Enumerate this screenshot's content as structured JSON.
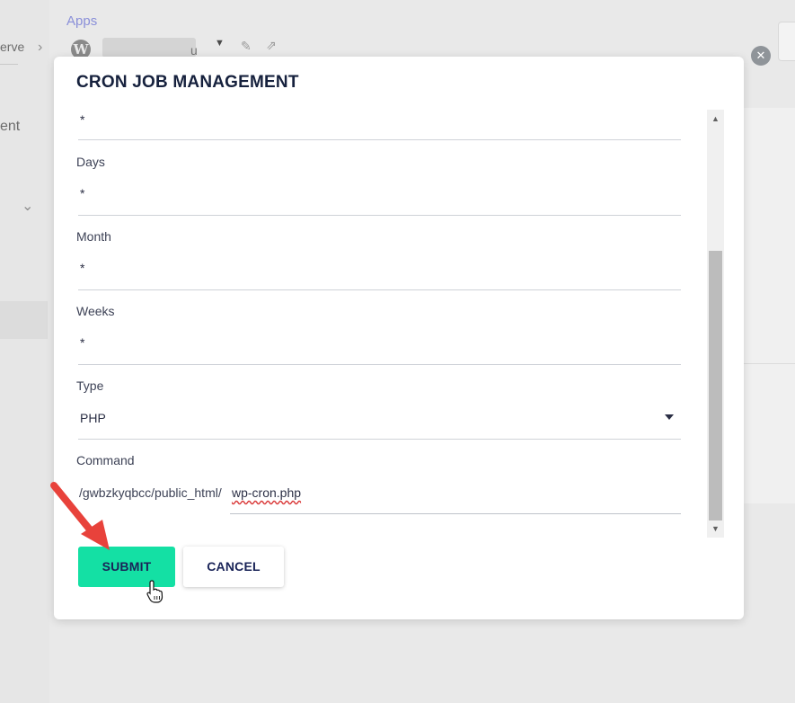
{
  "background": {
    "left_fragments": [
      "erve",
      "ent"
    ],
    "breadcrumb_apps": "Apps",
    "app_name_tail": "u",
    "wp_logo_letter": "W"
  },
  "modal": {
    "title": "CRON JOB MANAGEMENT",
    "fields": {
      "hours_value": "*",
      "days_label": "Days",
      "days_value": "*",
      "month_label": "Month",
      "month_value": "*",
      "weeks_label": "Weeks",
      "weeks_value": "*",
      "type_label": "Type",
      "type_value": "PHP",
      "command_label": "Command",
      "command_prefix": "/gwbzkyqbcc/public_html/",
      "command_value": "wp-cron.php"
    },
    "buttons": {
      "submit": "SUBMIT",
      "cancel": "CANCEL"
    },
    "close_icon": "close-icon"
  },
  "colors": {
    "submit_bg": "#14e0a4",
    "button_text": "#1a2458",
    "annotation_arrow": "#e8423b",
    "apps_link": "#8a8fd9"
  }
}
